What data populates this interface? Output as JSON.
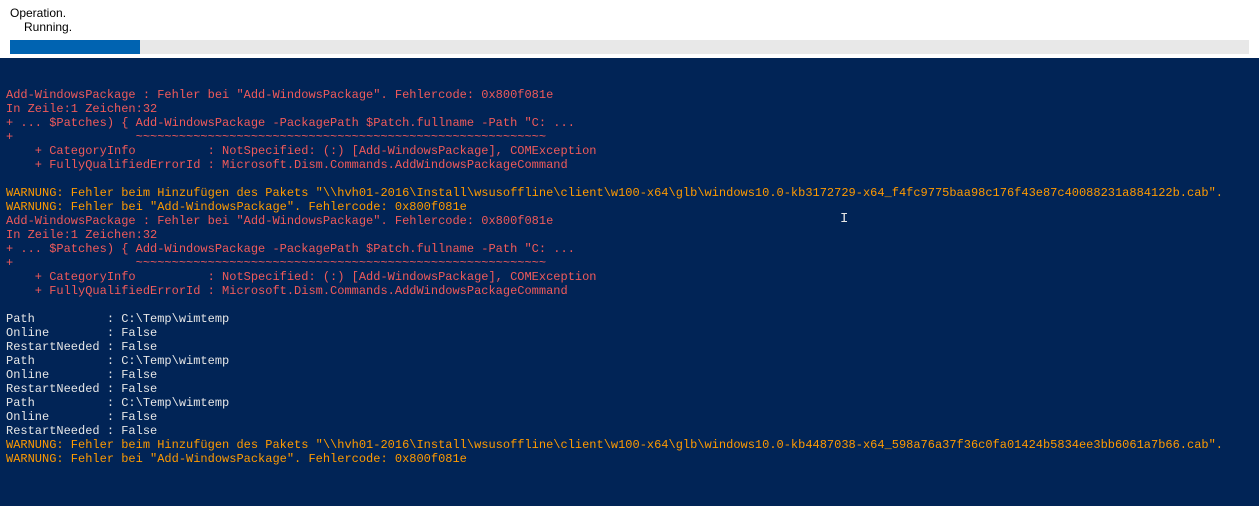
{
  "header": {
    "title": "Operation.",
    "status": "Running."
  },
  "progress": {
    "percent": 10.5
  },
  "console": {
    "lines": [
      {
        "cls": "err",
        "text": "Add-WindowsPackage : Fehler bei \"Add-WindowsPackage\". Fehlercode: 0x800f081e"
      },
      {
        "cls": "err",
        "text": "In Zeile:1 Zeichen:32"
      },
      {
        "cls": "err",
        "text": "+ ... $Patches) { Add-WindowsPackage -PackagePath $Patch.fullname -Path \"C: ..."
      },
      {
        "cls": "err",
        "text": "+                 ~~~~~~~~~~~~~~~~~~~~~~~~~~~~~~~~~~~~~~~~~~~~~~~~~~~~~~~~~"
      },
      {
        "cls": "err",
        "text": "    + CategoryInfo          : NotSpecified: (:) [Add-WindowsPackage], COMException"
      },
      {
        "cls": "err",
        "text": "    + FullyQualifiedErrorId : Microsoft.Dism.Commands.AddWindowsPackageCommand"
      },
      {
        "cls": "err",
        "text": " "
      },
      {
        "cls": "warn",
        "text": "WARNUNG: Fehler beim Hinzufügen des Pakets \"\\\\hvh01-2016\\Install\\wsusoffline\\client\\w100-x64\\glb\\windows10.0-kb3172729-x64_f4fc9775baa98c176f43e87c40088231a884122b.cab\"."
      },
      {
        "cls": "warn",
        "text": "WARNUNG: Fehler bei \"Add-WindowsPackage\". Fehlercode: 0x800f081e"
      },
      {
        "cls": "err",
        "text": "Add-WindowsPackage : Fehler bei \"Add-WindowsPackage\". Fehlercode: 0x800f081e"
      },
      {
        "cls": "err",
        "text": "In Zeile:1 Zeichen:32"
      },
      {
        "cls": "err",
        "text": "+ ... $Patches) { Add-WindowsPackage -PackagePath $Patch.fullname -Path \"C: ..."
      },
      {
        "cls": "err",
        "text": "+                 ~~~~~~~~~~~~~~~~~~~~~~~~~~~~~~~~~~~~~~~~~~~~~~~~~~~~~~~~~"
      },
      {
        "cls": "err",
        "text": "    + CategoryInfo          : NotSpecified: (:) [Add-WindowsPackage], COMException"
      },
      {
        "cls": "err",
        "text": "    + FullyQualifiedErrorId : Microsoft.Dism.Commands.AddWindowsPackageCommand"
      },
      {
        "cls": "err",
        "text": " "
      },
      {
        "cls": "txt",
        "text": ""
      },
      {
        "cls": "txt",
        "text": ""
      },
      {
        "cls": "txt",
        "text": "Path          : C:\\Temp\\wimtemp"
      },
      {
        "cls": "txt",
        "text": "Online        : False"
      },
      {
        "cls": "txt",
        "text": "RestartNeeded : False"
      },
      {
        "cls": "txt",
        "text": ""
      },
      {
        "cls": "txt",
        "text": "Path          : C:\\Temp\\wimtemp"
      },
      {
        "cls": "txt",
        "text": "Online        : False"
      },
      {
        "cls": "txt",
        "text": "RestartNeeded : False"
      },
      {
        "cls": "txt",
        "text": ""
      },
      {
        "cls": "txt",
        "text": "Path          : C:\\Temp\\wimtemp"
      },
      {
        "cls": "txt",
        "text": "Online        : False"
      },
      {
        "cls": "txt",
        "text": "RestartNeeded : False"
      },
      {
        "cls": "txt",
        "text": ""
      },
      {
        "cls": "warn",
        "text": "WARNUNG: Fehler beim Hinzufügen des Pakets \"\\\\hvh01-2016\\Install\\wsusoffline\\client\\w100-x64\\glb\\windows10.0-kb4487038-x64_598a76a37f36c0fa01424b5834ee3bb6061a7b66.cab\"."
      },
      {
        "cls": "warn",
        "text": "WARNUNG: Fehler bei \"Add-WindowsPackage\". Fehlercode: 0x800f081e"
      }
    ]
  }
}
